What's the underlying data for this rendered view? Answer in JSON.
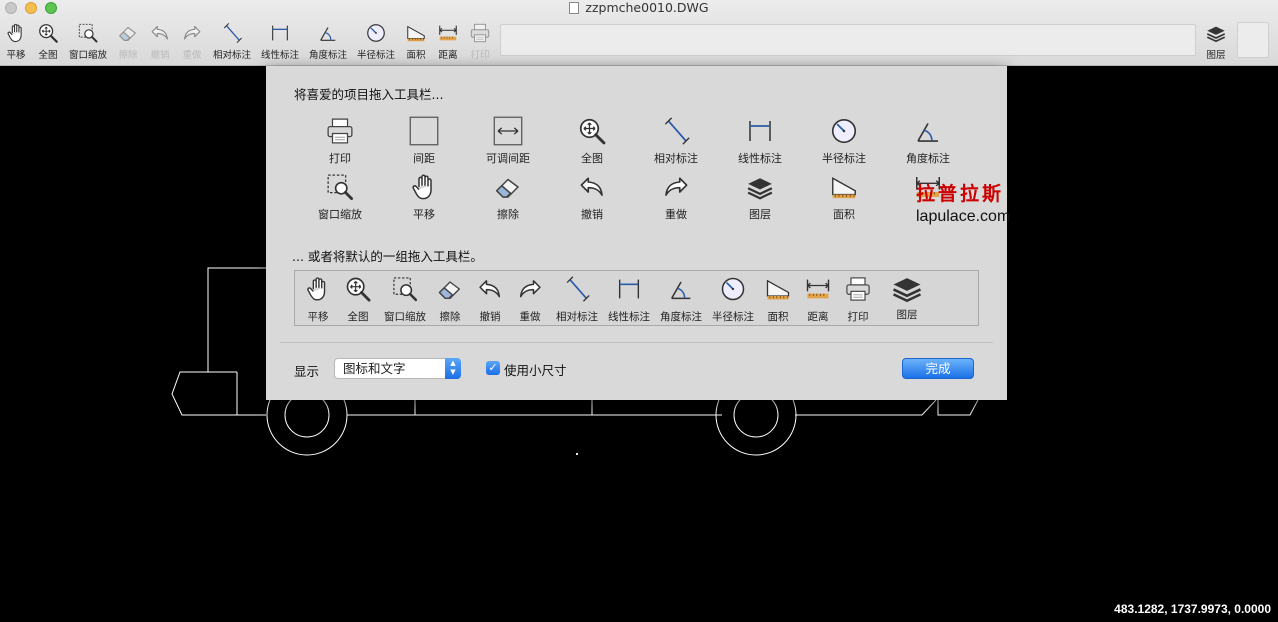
{
  "window": {
    "title": "zzpmche0010.DWG"
  },
  "toolbar": {
    "items": [
      {
        "label": "平移",
        "icon": "hand-icon"
      },
      {
        "label": "全图",
        "icon": "zoom-extents-icon"
      },
      {
        "label": "窗口缩放",
        "icon": "zoom-window-icon"
      },
      {
        "label": "擦除",
        "icon": "eraser-icon"
      },
      {
        "label": "撤销",
        "icon": "undo-icon"
      },
      {
        "label": "重做",
        "icon": "redo-icon"
      },
      {
        "label": "相对标注",
        "icon": "aligned-dimension-icon"
      },
      {
        "label": "线性标注",
        "icon": "linear-dimension-icon"
      },
      {
        "label": "角度标注",
        "icon": "angle-dimension-icon"
      },
      {
        "label": "半径标注",
        "icon": "radius-dimension-icon"
      },
      {
        "label": "面积",
        "icon": "area-icon"
      },
      {
        "label": "距离",
        "icon": "distance-icon"
      },
      {
        "label": "打印",
        "icon": "printer-icon"
      }
    ],
    "layers_label": "图层"
  },
  "sheet": {
    "heading_favorites": "将喜爱的项目拖入工具栏...",
    "palette": [
      {
        "label": "打印",
        "icon": "printer-icon"
      },
      {
        "label": "间距",
        "icon": "space-icon"
      },
      {
        "label": "可调间距",
        "icon": "flexible-space-icon"
      },
      {
        "label": "全图",
        "icon": "zoom-extents-icon"
      },
      {
        "label": "相对标注",
        "icon": "aligned-dimension-icon"
      },
      {
        "label": "线性标注",
        "icon": "linear-dimension-icon"
      },
      {
        "label": "半径标注",
        "icon": "radius-dimension-icon"
      },
      {
        "label": "角度标注",
        "icon": "angle-dimension-icon"
      },
      {
        "label": "窗口缩放",
        "icon": "zoom-window-icon"
      },
      {
        "label": "平移",
        "icon": "hand-icon"
      },
      {
        "label": "擦除",
        "icon": "eraser-icon"
      },
      {
        "label": "撤销",
        "icon": "undo-icon"
      },
      {
        "label": "重做",
        "icon": "redo-icon"
      },
      {
        "label": "图层",
        "icon": "layers-icon"
      },
      {
        "label": "面积",
        "icon": "area-icon"
      },
      {
        "label": "",
        "icon": "distance-icon"
      }
    ],
    "heading_default": "... 或者将默认的一组拖入工具栏。",
    "default_set": [
      "平移",
      "全图",
      "窗口缩放",
      "擦除",
      "撤销",
      "重做",
      "相对标注",
      "线性标注",
      "角度标注",
      "半径标注",
      "面积",
      "距离",
      "打印",
      "图层"
    ],
    "show_label": "显示",
    "show_value": "图标和文字",
    "small_size_label": "使用小尺寸",
    "small_size_checked": true,
    "done_label": "完成"
  },
  "watermark": {
    "cn": "拉普拉斯",
    "en": "lapulace.com"
  },
  "status": {
    "coordinates": "483.1282, 1737.9973, 0.0000"
  },
  "colors": {
    "accent": "#1c71e8",
    "watermark": "#cc0000",
    "canvas": "#000000"
  }
}
